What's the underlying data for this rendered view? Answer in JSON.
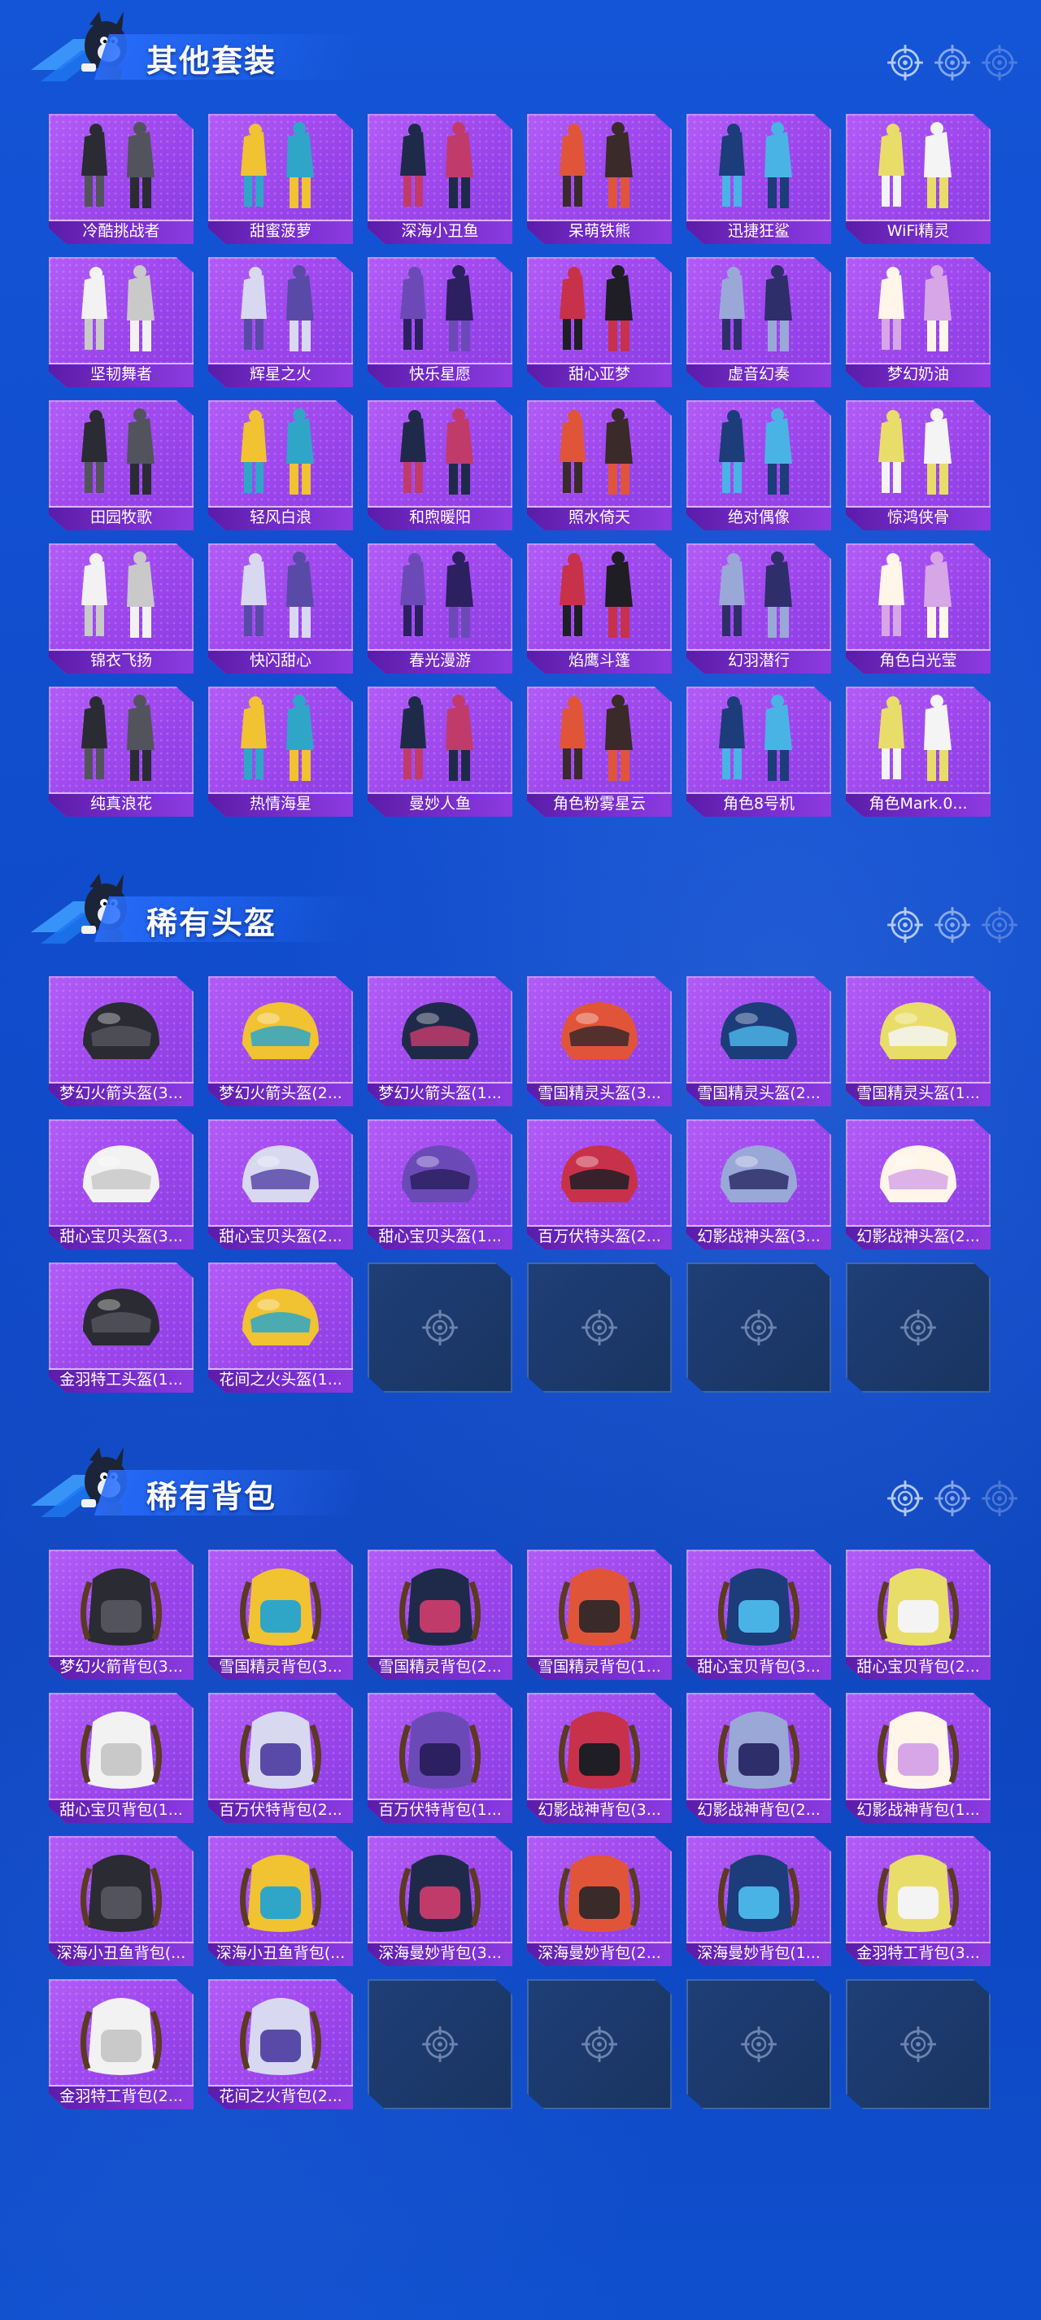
{
  "colors": {
    "background": "#1150d2",
    "card_purple": "#a450f2",
    "label_strip": "#6a25bd",
    "empty_slot": "#1c3b70"
  },
  "sections": [
    {
      "title": "其他套装",
      "items": [
        "冷酷挑战者",
        "甜蜜菠萝",
        "深海小丑鱼",
        "呆萌铁熊",
        "迅捷狂鲨",
        "WiFi精灵",
        "坚韧舞者",
        "辉星之火",
        "快乐星愿",
        "甜心亚梦",
        "虚音幻奏",
        "梦幻奶油",
        "田园牧歌",
        "轻风白浪",
        "和煦暖阳",
        "照水倚天",
        "绝对偶像",
        "惊鸿侠骨",
        "锦衣飞扬",
        "快闪甜心",
        "春光漫游",
        "焰鹰斗篷",
        "幻羽潜行",
        "角色白光莹",
        "纯真浪花",
        "热情海星",
        "曼妙人鱼",
        "角色粉雾星云",
        "角色8号机",
        "角色Mark.0..."
      ],
      "empty_slots": 0
    },
    {
      "title": "稀有头盔",
      "items": [
        "梦幻火箭头盔(3...",
        "梦幻火箭头盔(2...",
        "梦幻火箭头盔(1...",
        "雪国精灵头盔(3...",
        "雪国精灵头盔(2...",
        "雪国精灵头盔(1...",
        "甜心宝贝头盔(3...",
        "甜心宝贝头盔(2...",
        "甜心宝贝头盔(1...",
        "百万伏特头盔(2...",
        "幻影战神头盔(3...",
        "幻影战神头盔(2...",
        "金羽特工头盔(1...",
        "花间之火头盔(1..."
      ],
      "empty_slots": 4
    },
    {
      "title": "稀有背包",
      "items": [
        "梦幻火箭背包(3...",
        "雪国精灵背包(3...",
        "雪国精灵背包(2...",
        "雪国精灵背包(1...",
        "甜心宝贝背包(3...",
        "甜心宝贝背包(2...",
        "甜心宝贝背包(1...",
        "百万伏特背包(2...",
        "百万伏特背包(1...",
        "幻影战神背包(3...",
        "幻影战神背包(2...",
        "幻影战神背包(1...",
        "深海小丑鱼背包(...",
        "深海小丑鱼背包(...",
        "深海曼妙背包(3...",
        "深海曼妙背包(2...",
        "深海曼妙背包(1...",
        "金羽特工背包(3...",
        "金羽特工背包(2...",
        "花间之火背包(2..."
      ],
      "empty_slots": 4
    }
  ]
}
